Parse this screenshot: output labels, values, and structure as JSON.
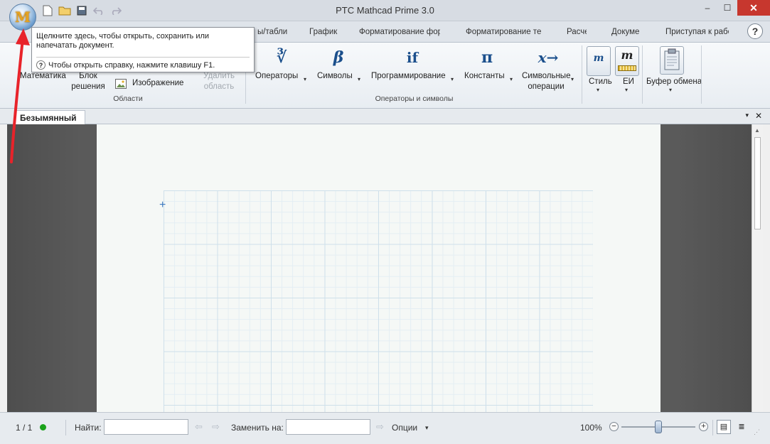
{
  "window": {
    "title": "PTC Mathcad Prime 3.0",
    "orb_letter": "M",
    "controls": {
      "minimize": "–",
      "maximize": "☐",
      "close": "✕"
    }
  },
  "quick_access": [
    "new-icon",
    "open-folder-icon",
    "save-icon",
    "undo-icon",
    "redo-icon"
  ],
  "tabs": [
    "ы/таблиц",
    "График",
    "Форматирование форм",
    "Форматирование тек",
    "Расче",
    "Докуме",
    "Приступая к рабо"
  ],
  "help_label": "?",
  "tooltip": {
    "main": "Щелкните здесь, чтобы открыть, сохранить или напечатать документ.",
    "help": "Чтобы открыть справку, нажмите клавишу F1."
  },
  "ribbon": {
    "regions": {
      "math": "Математика",
      "block_line1": "Блок",
      "block_line2": "решения",
      "image": "Изображение",
      "delete_line1": "Удалить",
      "delete_line2": "область",
      "group_label": "Области"
    },
    "operators": {
      "operators": {
        "symbol": "∛",
        "label": "Операторы"
      },
      "symbols": {
        "symbol": "β",
        "label": "Символы"
      },
      "programming": {
        "symbol": "if",
        "label": "Программирование"
      },
      "constants": {
        "symbol": "π",
        "label": "Константы"
      },
      "symbolic": {
        "symbol": "x→",
        "label_line1": "Символьные",
        "label_line2": "операции"
      },
      "group_label": "Операторы и символы"
    },
    "style": {
      "symbol": "m",
      "label": "Стиль"
    },
    "units": {
      "symbol": "m",
      "label": "ЕИ"
    },
    "clipboard": {
      "label": "Буфер обмена"
    },
    "caret": "▾"
  },
  "document": {
    "tab": "Безымянный",
    "dropdown": "▾",
    "close": "✕",
    "cursor": "+"
  },
  "status": {
    "page": "1 / 1",
    "status_color": "#1aa21a",
    "find_label": "Найти:",
    "find_value": "",
    "replace_label": "Заменить на:",
    "replace_value": "",
    "options_label": "Опции",
    "options_caret": "▾",
    "zoom_text": "100%",
    "zoom_minus": "−",
    "zoom_plus": "+",
    "zoom_level": 0.5
  },
  "annotation_color": "#e8232a"
}
